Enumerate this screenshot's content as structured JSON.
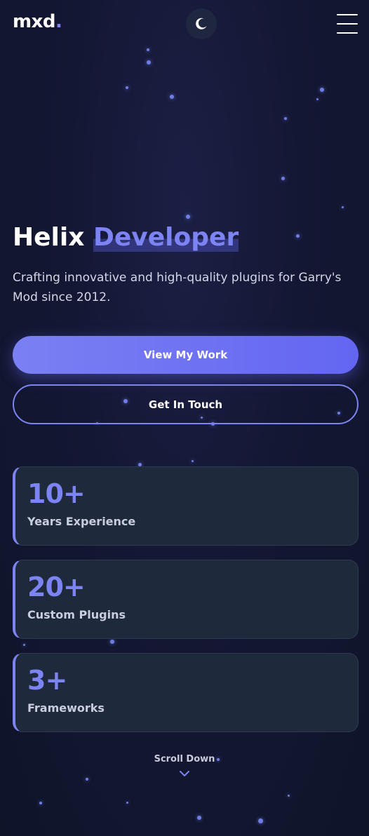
{
  "header": {
    "logo_text": "mxd",
    "logo_dot": ".",
    "theme_toggle_icon": "moon-icon",
    "menu_icon": "hamburger-menu-icon"
  },
  "hero": {
    "title_plain": "Helix",
    "title_accent": "Developer",
    "subtitle": "Crafting innovative and high-quality plugins for Garry's Mod since 2012.",
    "primary_button": "View My Work",
    "secondary_button": "Get In Touch"
  },
  "stats": [
    {
      "value": "10+",
      "label": "Years Experience"
    },
    {
      "value": "20+",
      "label": "Custom Plugins"
    },
    {
      "value": "3+",
      "label": "Frameworks"
    }
  ],
  "scroll": {
    "label": "Scroll Down",
    "icon": "chevron-down-icon"
  },
  "colors": {
    "accent": "#7c83f3",
    "primary_button": "#6366f1",
    "card_background": "#1e293b",
    "page_background": "#141733"
  }
}
